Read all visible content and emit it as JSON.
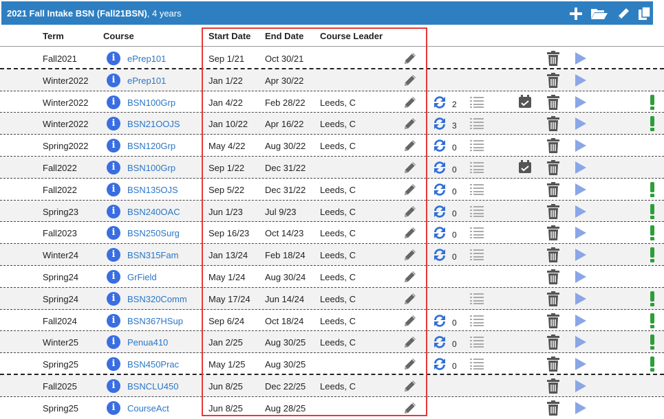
{
  "titlebar": {
    "title": "2021 Fall Intake BSN (Fall21BSN)",
    "years": ", 4 years",
    "icons": [
      "plus-icon",
      "folder-open-icon",
      "pencil-icon",
      "copy-icon"
    ]
  },
  "header": {
    "term": "Term",
    "course": "Course",
    "start": "Start Date",
    "end": "End Date",
    "leader": "Course Leader"
  },
  "rows": [
    {
      "term": "Fall2021",
      "course": "ePrep101",
      "start": "Sep 1/21",
      "end": "Oct 30/21",
      "leader": "",
      "sync": null,
      "list": false,
      "cal": false,
      "warn": false
    },
    {
      "term": "Winter2022",
      "course": "ePrep101",
      "start": "Jan 1/22",
      "end": "Apr 30/22",
      "leader": "",
      "sync": null,
      "list": false,
      "cal": false,
      "warn": false
    },
    {
      "term": "Winter2022",
      "course": "BSN100Grp",
      "start": "Jan 4/22",
      "end": "Feb 28/22",
      "leader": "Leeds, C",
      "sync": "2",
      "list": true,
      "cal": true,
      "warn": true
    },
    {
      "term": "Winter2022",
      "course": "BSN21OOJS",
      "start": "Jan 10/22",
      "end": "Apr 16/22",
      "leader": "Leeds, C",
      "sync": "3",
      "list": true,
      "cal": false,
      "warn": true
    },
    {
      "term": "Spring2022",
      "course": "BSN120Grp",
      "start": "May 4/22",
      "end": "Aug 30/22",
      "leader": "Leeds, C",
      "sync": "0",
      "list": true,
      "cal": false,
      "warn": false
    },
    {
      "term": "Fall2022",
      "course": "BSN100Grp",
      "start": "Sep 1/22",
      "end": "Dec 31/22",
      "leader": "",
      "sync": "0",
      "list": true,
      "cal": true,
      "warn": false
    },
    {
      "term": "Fall2022",
      "course": "BSN135OJS",
      "start": "Sep 5/22",
      "end": "Dec 31/22",
      "leader": "Leeds, C",
      "sync": "0",
      "list": true,
      "cal": false,
      "warn": true
    },
    {
      "term": "Spring23",
      "course": "BSN240OAC",
      "start": "Jun 1/23",
      "end": "Jul 9/23",
      "leader": "Leeds, C",
      "sync": "0",
      "list": true,
      "cal": false,
      "warn": true
    },
    {
      "term": "Fall2023",
      "course": "BSN250Surg",
      "start": "Sep 16/23",
      "end": "Oct 14/23",
      "leader": "Leeds, C",
      "sync": "0",
      "list": true,
      "cal": false,
      "warn": true
    },
    {
      "term": "Winter24",
      "course": "BSN315Fam",
      "start": "Jan 13/24",
      "end": "Feb 18/24",
      "leader": "Leeds, C",
      "sync": "0",
      "list": true,
      "cal": false,
      "warn": true
    },
    {
      "term": "Spring24",
      "course": "GrField",
      "start": "May 1/24",
      "end": "Aug 30/24",
      "leader": "Leeds, C",
      "sync": null,
      "list": false,
      "cal": false,
      "warn": false
    },
    {
      "term": "Spring24",
      "course": "BSN320Comm",
      "start": "May 17/24",
      "end": "Jun 14/24",
      "leader": "Leeds, C",
      "sync": null,
      "list": true,
      "cal": false,
      "warn": true
    },
    {
      "term": "Fall2024",
      "course": "BSN367HSup",
      "start": "Sep 6/24",
      "end": "Oct 18/24",
      "leader": "Leeds, C",
      "sync": "0",
      "list": true,
      "cal": false,
      "warn": true
    },
    {
      "term": "Winter25",
      "course": "Penua410",
      "start": "Jan 2/25",
      "end": "Aug 30/25",
      "leader": "Leeds, C",
      "sync": "0",
      "list": true,
      "cal": false,
      "warn": true
    },
    {
      "term": "Spring25",
      "course": "BSN450Prac",
      "start": "May 1/25",
      "end": "Aug 30/25",
      "leader": "",
      "sync": "0",
      "list": true,
      "cal": false,
      "warn": true
    },
    {
      "term": "Fall2025",
      "course": "BSNCLU450",
      "start": "Jun 8/25",
      "end": "Dec 22/25",
      "leader": "Leeds, C",
      "sync": null,
      "list": false,
      "cal": false,
      "warn": false
    },
    {
      "term": "Spring25",
      "course": "CourseAct",
      "start": "Jun 8/25",
      "end": "Aug 28/25",
      "leader": "",
      "sync": null,
      "list": false,
      "cal": false,
      "warn": false
    }
  ],
  "colors": {
    "titlebar": "#2e7fc1",
    "link": "#2a76c6",
    "info": "#3a6ee0",
    "sync": "#2f6fd6",
    "play": "#8aa6e6",
    "warn": "#2e9e3a",
    "highlight": "#e53935"
  }
}
